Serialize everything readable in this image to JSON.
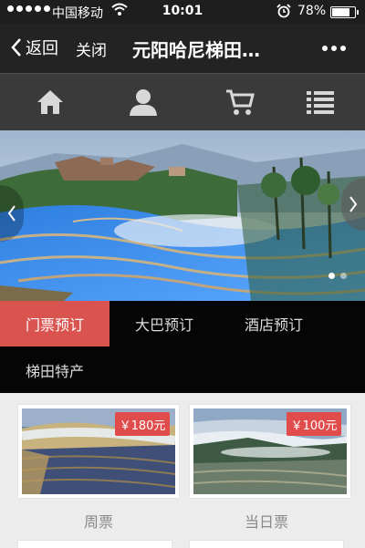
{
  "status_bar": {
    "carrier": "中国移动",
    "time": "10:01",
    "battery": "78%",
    "battery_level": 0.78,
    "icons": [
      "signal-dots-icon",
      "wifi-icon",
      "alarm-icon",
      "battery-icon"
    ]
  },
  "nav": {
    "back_label": "返回",
    "close_label": "关闭",
    "title": "元阳哈尼梯田…",
    "more_icon": "more-dots-icon"
  },
  "menu": {
    "items": [
      {
        "icon": "home-icon"
      },
      {
        "icon": "user-icon"
      },
      {
        "icon": "cart-icon"
      },
      {
        "icon": "list-icon"
      }
    ]
  },
  "banner": {
    "icons": [
      "chevron-left-icon",
      "chevron-right-icon"
    ],
    "slide_count": 2,
    "active_slide": 1
  },
  "tabs": [
    {
      "label": "门票预订",
      "active": true
    },
    {
      "label": "大巴预订",
      "active": false
    },
    {
      "label": "酒店预订",
      "active": false
    },
    {
      "label": "梯田特产",
      "active": false
    }
  ],
  "products": [
    {
      "price": "￥180元",
      "name": "周票"
    },
    {
      "price": "￥100元",
      "name": "当日票"
    }
  ],
  "colors": {
    "accent": "#d9534f",
    "navbar": "#232323",
    "menubar": "#3a3a3a",
    "tabbar": "#050505",
    "price_badge": "#e04b4b"
  }
}
